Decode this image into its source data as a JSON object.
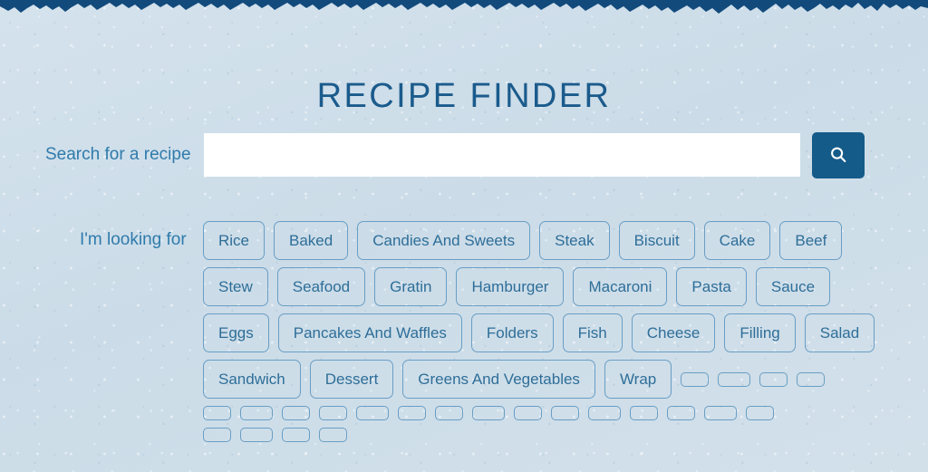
{
  "theme": {
    "background_color": "#d2e0ea",
    "banner_color": "#124a7c",
    "title_color": "#1b5b8c",
    "label_color": "#2f7bab",
    "tag_border_color": "#6a9ec4",
    "tag_text_color": "#2e6e98",
    "button_color": "#145b8a",
    "input_background": "#ffffff"
  },
  "header": {
    "title": "RECIPE FINDER"
  },
  "search": {
    "label": "Search for a recipe",
    "value": "",
    "placeholder": "",
    "button_icon": "search-icon"
  },
  "filters": {
    "label": "I'm looking for",
    "rows": [
      {
        "tags": [
          "Rice",
          "Baked",
          "Candies And Sweets",
          "Steak",
          "Biscuit",
          "Cake",
          "Beef"
        ],
        "empty_count": 0
      },
      {
        "tags": [
          "Stew",
          "Seafood",
          "Gratin",
          "Hamburger",
          "Macaroni",
          "Pasta",
          "Sauce"
        ],
        "empty_count": 0
      },
      {
        "tags": [
          "Eggs",
          "Pancakes And Waffles",
          "Folders",
          "Fish",
          "Cheese",
          "Filling",
          "Salad"
        ],
        "empty_count": 0
      },
      {
        "tags": [
          "Sandwich",
          "Dessert",
          "Greens And Vegetables",
          "Wrap"
        ],
        "empty_count": 4
      },
      {
        "tags": [],
        "empty_count": 15
      },
      {
        "tags": [],
        "empty_count": 4
      }
    ]
  }
}
